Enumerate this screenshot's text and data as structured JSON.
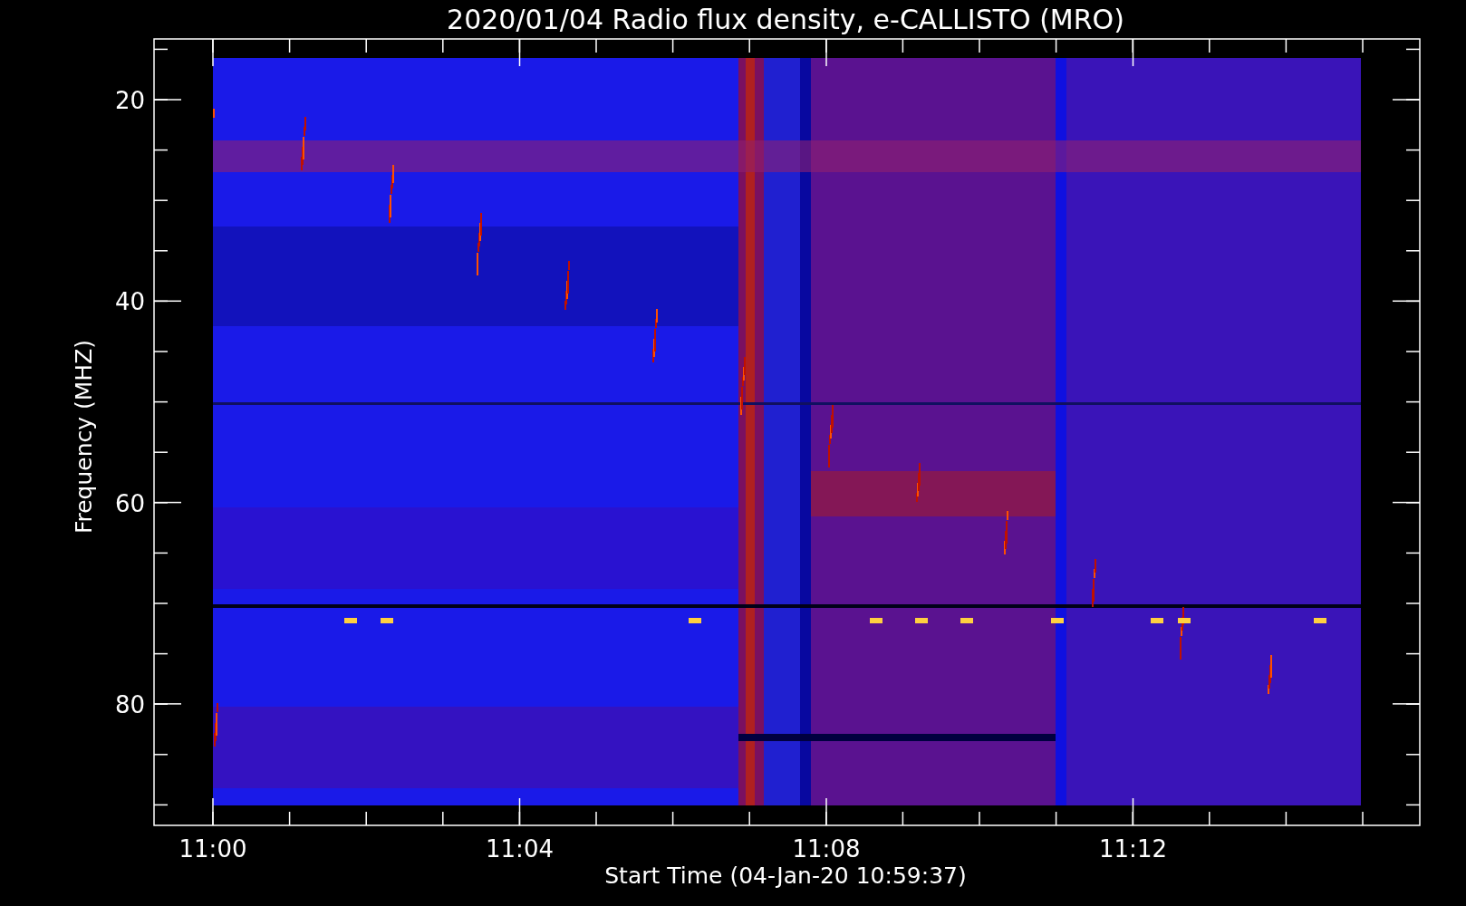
{
  "chart": {
    "title": "2020/01/04  Radio flux density, e-CALLISTO (MRO)",
    "ylabel": "Frequency (MHZ)",
    "xlabel": "Start Time (04-Jan-20 10:59:37)",
    "yticks": [
      "20",
      "40",
      "60",
      "80"
    ],
    "xticks": [
      "11:00",
      "11:04",
      "11:08",
      "11:12"
    ]
  }
}
